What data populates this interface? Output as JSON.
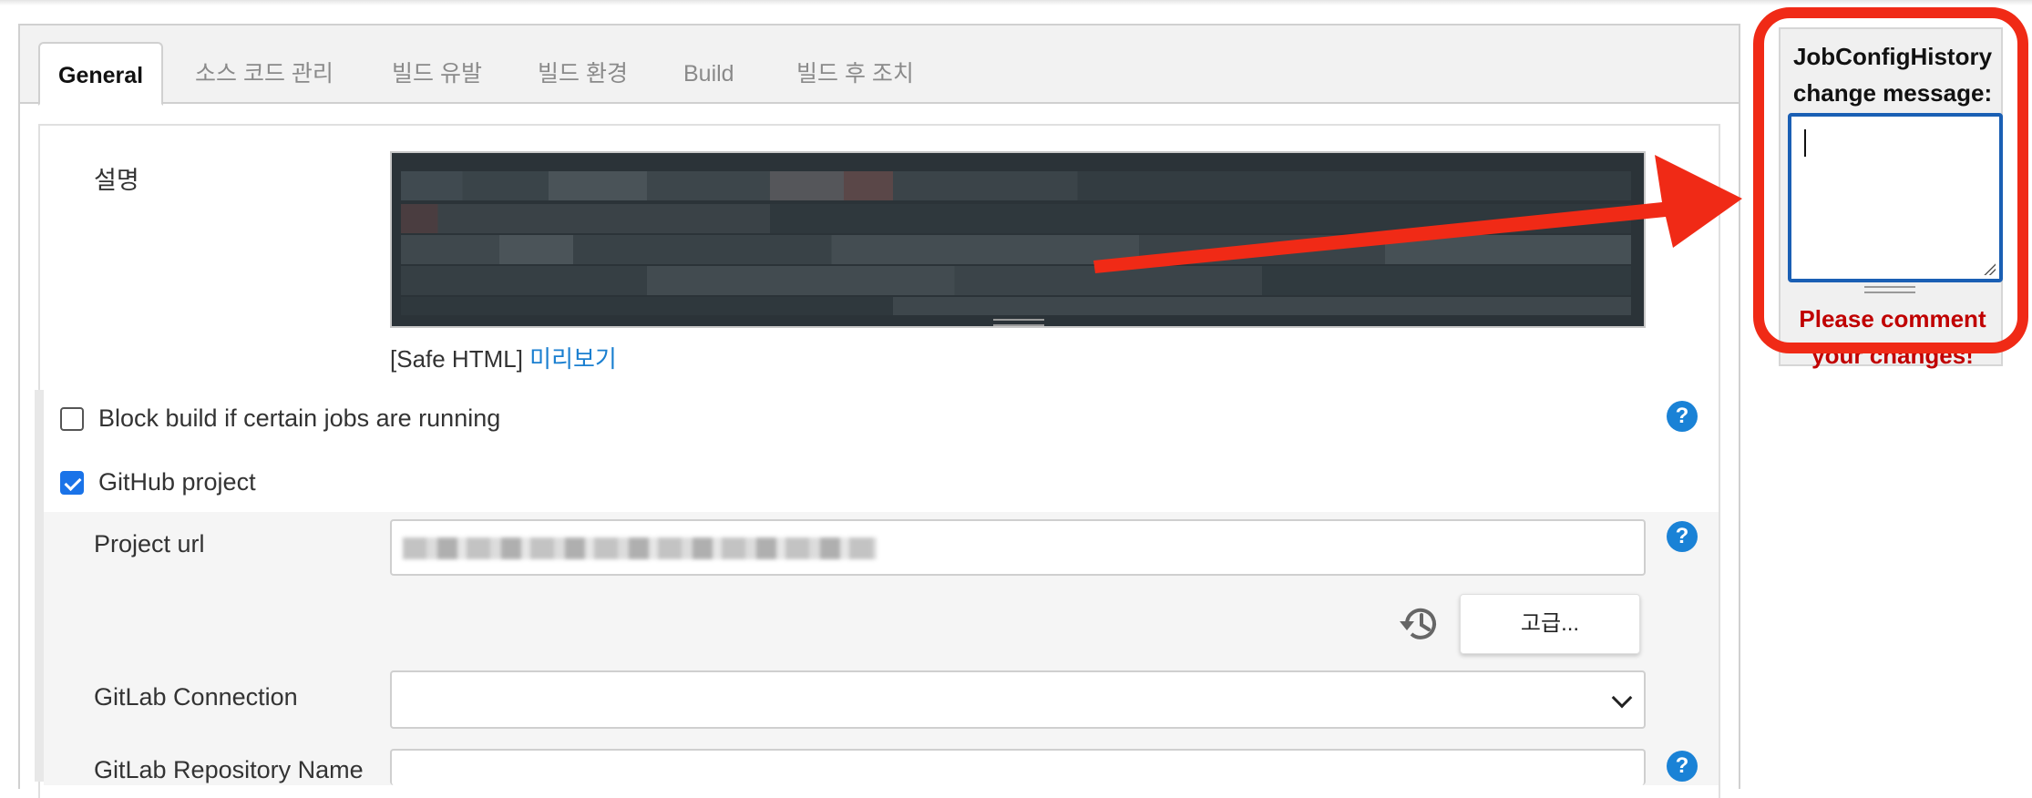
{
  "tabs": [
    {
      "label": "General",
      "active": true
    },
    {
      "label": "소스 코드 관리",
      "active": false
    },
    {
      "label": "빌드 유발",
      "active": false
    },
    {
      "label": "빌드 환경",
      "active": false
    },
    {
      "label": "Build",
      "active": false
    },
    {
      "label": "빌드 후 조치",
      "active": false
    }
  ],
  "description": {
    "label": "설명",
    "safe_html_label": "[Safe HTML]",
    "preview_link": "미리보기"
  },
  "options": {
    "block_build_label": "Block build if certain jobs are running",
    "block_build_checked": false,
    "github_project_label": "GitHub project",
    "github_project_checked": true
  },
  "github": {
    "project_url_label": "Project url",
    "advanced_button": "고급...",
    "history_icon": "history-icon"
  },
  "gitlab": {
    "connection_label": "GitLab Connection",
    "connection_value": "",
    "repository_label": "GitLab Repository Name"
  },
  "help_icon_text": "?",
  "change_message": {
    "title": "JobConfigHistory change message:",
    "value": "",
    "warning": "Please comment your changes!"
  },
  "colors": {
    "accent": "#1a82d6",
    "highlight": "#f02a16",
    "warning": "#c00000"
  }
}
